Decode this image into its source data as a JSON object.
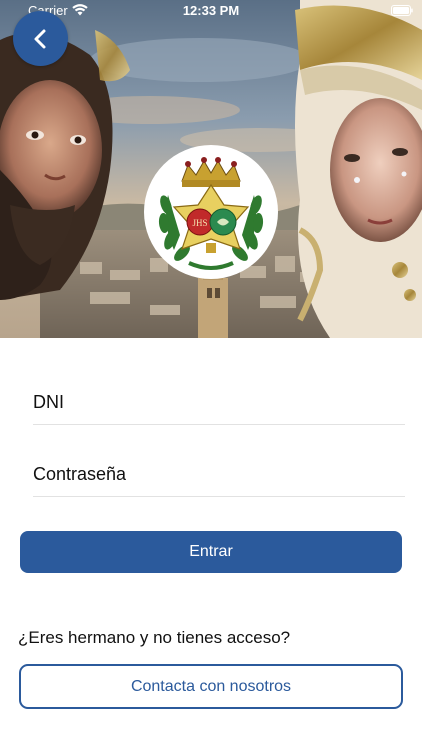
{
  "status_bar": {
    "carrier": "Carrier",
    "time": "12:33 PM",
    "wifi_icon": "wifi-icon",
    "battery_icon": "battery-icon"
  },
  "header": {
    "back_icon": "chevron-left-icon",
    "crest_icon": "brotherhood-crest"
  },
  "form": {
    "dni_placeholder": "DNI",
    "password_placeholder": "Contraseña",
    "login_label": "Entrar"
  },
  "footer": {
    "question": "¿Eres hermano y no tienes acceso?",
    "contact_label": "Contacta con nosotros"
  },
  "colors": {
    "primary": "#2b5a9c",
    "background": "#ffffff",
    "text": "#111111",
    "divider": "#e2e2e2"
  }
}
